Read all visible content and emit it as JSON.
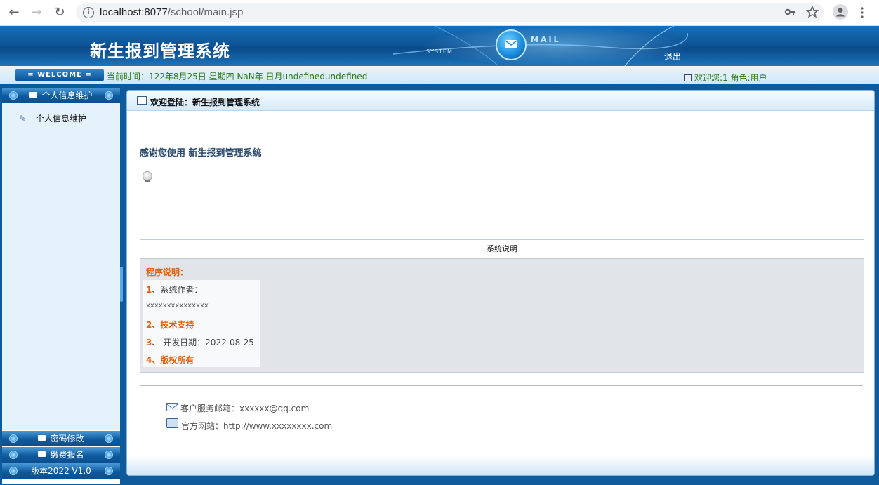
{
  "browser": {
    "url_host": "localhost:8077",
    "url_path": "/school/main.jsp",
    "icons": [
      "back-arrow-icon",
      "forward-arrow-icon",
      "reload-icon",
      "info-icon",
      "key-icon",
      "star-icon",
      "profile-icon",
      "menu-dots-icon"
    ]
  },
  "header": {
    "title": "新生报到管理系统",
    "system_label": "SYSTEM",
    "mail_label": "MAIL",
    "logout": "退出"
  },
  "welcome_bar": {
    "badge": "= WELCOME =",
    "time": "当前时间：122年8月25日 星期四 NaN年 日月undefinedundefined",
    "user": "欢迎您:1 角色:用户"
  },
  "sidebar": {
    "sections": [
      {
        "label": "个人信息维护"
      },
      {
        "label": "密码修改"
      },
      {
        "label": "缴费报名"
      },
      {
        "label": "版本2022 V1.0"
      }
    ],
    "items": [
      {
        "label": "个人信息维护"
      }
    ]
  },
  "main": {
    "panel_title": "欢迎登陆：新生报到管理系统",
    "thanks": "感谢您使用 新生报到管理系统",
    "table_header": "系统说明",
    "program_title": "程序说明：",
    "rows": {
      "r1_num": "1",
      "r1_text": "、系统作者：",
      "r1_value": "xxxxxxxxxxxxxxx",
      "r2": "2、技术支持",
      "r3_num": "3",
      "r3_text": "、 开发日期：2022-08-25",
      "r4": "4、版权所有"
    },
    "contact": {
      "email": "客户服务邮箱：xxxxxx@qq.com",
      "website": "官方网站：http://www.xxxxxxxx.com"
    }
  },
  "colors": {
    "header_blue": "#0d5598",
    "accent_orange": "#e0620e",
    "green_text": "#2d7a14"
  }
}
